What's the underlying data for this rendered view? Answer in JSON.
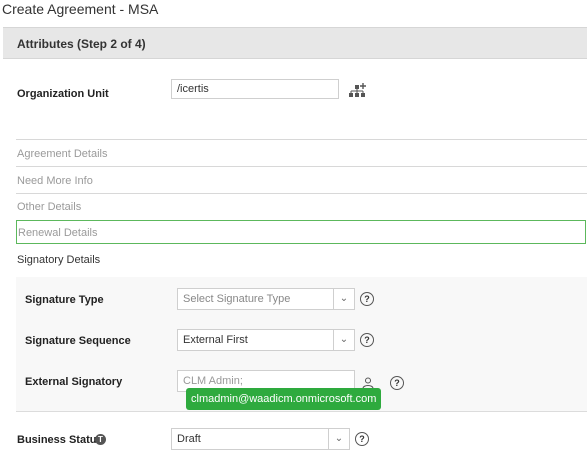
{
  "page": {
    "title": "Create Agreement - MSA"
  },
  "step": {
    "title": "Attributes (Step 2 of 4)"
  },
  "organization": {
    "label": "Organization Unit",
    "value": "/icertis",
    "icon": "add-hierarchy-icon"
  },
  "sections": [
    {
      "label": "Agreement Details"
    },
    {
      "label": "Need More Info"
    },
    {
      "label": "Other Details"
    },
    {
      "label": "Renewal Details"
    },
    {
      "label": "Signatory Details"
    }
  ],
  "signatory": {
    "signature_type": {
      "label": "Signature Type",
      "placeholder": "Select Signature Type"
    },
    "signature_sequence": {
      "label": "Signature Sequence",
      "value": "External First"
    },
    "external_signatory": {
      "label": "External Signatory",
      "value": "CLM Admin;",
      "icon": "person-icon"
    },
    "tooltip": "clmadmin@waadicm.onmicrosoft.com"
  },
  "business_status": {
    "label": "Business Status",
    "value": "Draft",
    "info_icon": "info-icon"
  },
  "icons": {
    "help": "?",
    "caret": "⌄",
    "info": "T"
  }
}
